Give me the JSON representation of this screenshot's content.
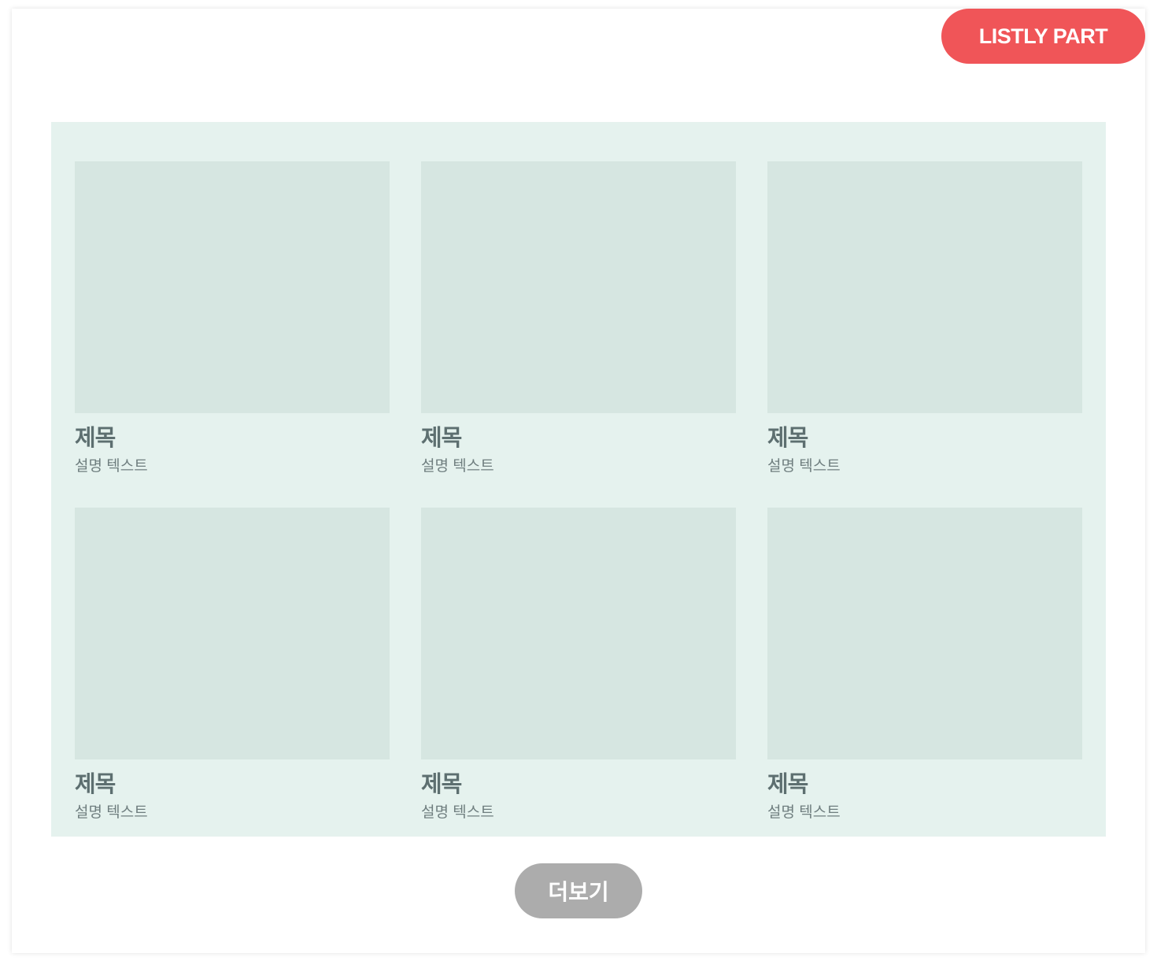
{
  "badge": {
    "label": "LISTLY PART"
  },
  "cards": [
    {
      "title": "제목",
      "description": "설명 텍스트"
    },
    {
      "title": "제목",
      "description": "설명 텍스트"
    },
    {
      "title": "제목",
      "description": "설명 텍스트"
    },
    {
      "title": "제목",
      "description": "설명 텍스트"
    },
    {
      "title": "제목",
      "description": "설명 텍스트"
    },
    {
      "title": "제목",
      "description": "설명 텍스트"
    }
  ],
  "more_button": {
    "label": "더보기"
  },
  "colors": {
    "badge": "#f05558",
    "panel": "#e5f2ee",
    "thumbnail": "#d6e6e1",
    "more_button": "#acacac"
  }
}
